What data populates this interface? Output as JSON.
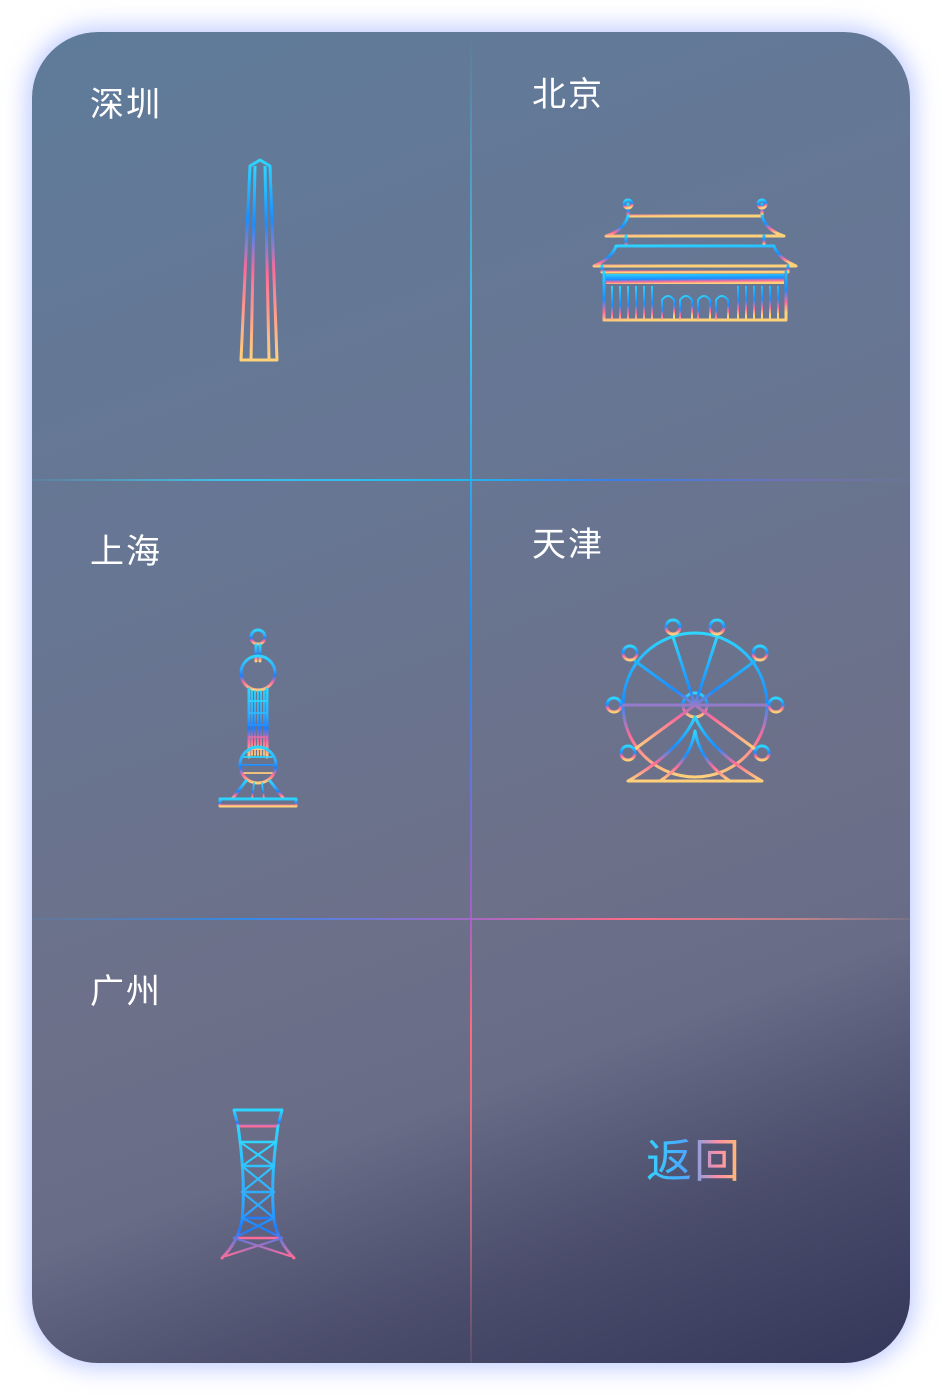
{
  "cities": [
    {
      "id": "shenzhen",
      "name": "深圳",
      "landmark_icon": "ping-an-tower-icon"
    },
    {
      "id": "beijing",
      "name": "北京",
      "landmark_icon": "tiananmen-gate-icon"
    },
    {
      "id": "shanghai",
      "name": "上海",
      "landmark_icon": "oriental-pearl-tower-icon"
    },
    {
      "id": "tianjin",
      "name": "天津",
      "landmark_icon": "tianjin-eye-ferris-wheel-icon"
    },
    {
      "id": "guangzhou",
      "name": "广州",
      "landmark_icon": "canton-tower-icon"
    }
  ],
  "back_button": {
    "label": "返回"
  },
  "colors": {
    "icon_gradient": [
      "#2ed6ff",
      "#1a8dff",
      "#ff6b9a",
      "#ffd27a"
    ],
    "text": "#ffffff",
    "card_glow": "#96aaff"
  }
}
